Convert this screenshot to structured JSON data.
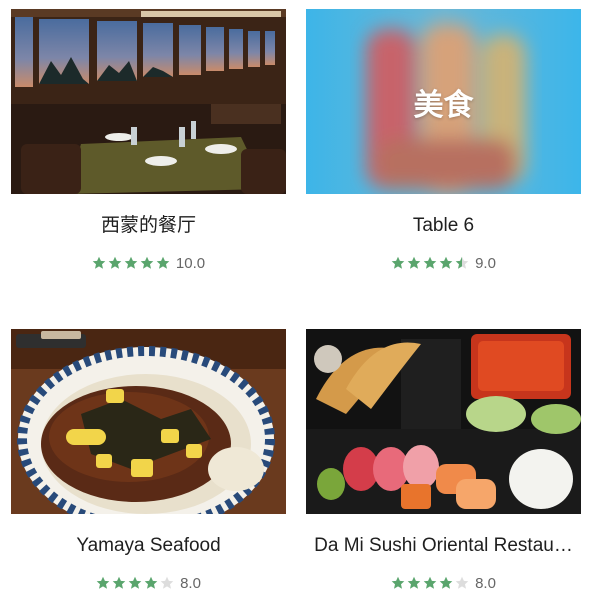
{
  "colors": {
    "star_on": "#5aa56d",
    "star_off": "#dddddd",
    "score": "#666666"
  },
  "cards": [
    {
      "name": "西蒙的餐厅",
      "score": "10.0",
      "stars": 5.0,
      "image": "restaurant-interior-photo"
    },
    {
      "name": "Table 6",
      "score": "9.0",
      "stars": 4.5,
      "image": "food-banner",
      "banner_text": "美食"
    },
    {
      "name": "Yamaya Seafood",
      "score": "8.0",
      "stars": 4.0,
      "image": "eel-rice-bowl-photo"
    },
    {
      "name": "Da Mi Sushi Oriental Restau…",
      "score": "8.0",
      "stars": 4.0,
      "image": "sushi-bento-photo"
    }
  ]
}
